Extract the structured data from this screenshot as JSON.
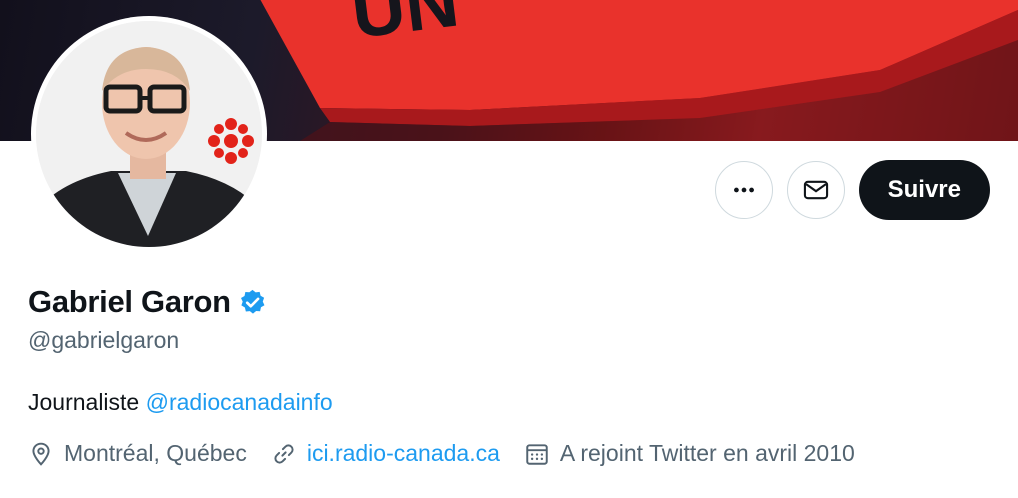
{
  "profile": {
    "name": "Gabriel Garon",
    "handle": "@gabrielgaron",
    "bio_text": "Journaliste ",
    "bio_mention": "@radiocanadainfo",
    "location": "Montréal, Québec",
    "website": "ici.radio-canada.ca",
    "joined": "A rejoint Twitter en avril 2010"
  },
  "actions": {
    "follow_label": "Suivre",
    "more_icon": "more-horizontal-icon",
    "message_icon": "envelope-icon"
  },
  "colors": {
    "link": "#1d9bf0",
    "follow_bg": "#0f1419",
    "secondary_text": "#536471",
    "verified": "#1d9bf0",
    "cbc_red": "#e2231a"
  }
}
